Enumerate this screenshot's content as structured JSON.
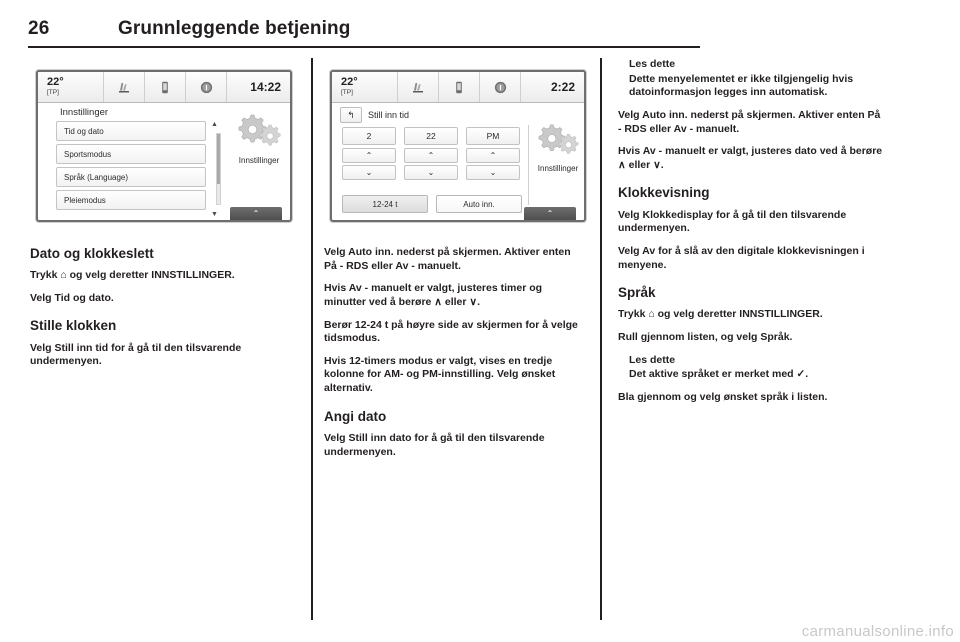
{
  "header": {
    "page_number": "26",
    "title": "Grunnleggende betjening"
  },
  "screens": {
    "screen1": {
      "status": {
        "temperature": "22°",
        "tp": "[TP]",
        "time": "14:22",
        "icons": [
          "seat-heating-icon",
          "phone-icon",
          "info-icon"
        ]
      },
      "title": "Innstillinger",
      "menu_items": [
        "Tid og dato",
        "Sportsmodus",
        "Språk (Language)",
        "Pleiemodus"
      ],
      "scroll_up": "▲",
      "scroll_down": "▼",
      "right_label": "Innstillinger",
      "home_chevron": "⌃"
    },
    "screen2": {
      "status": {
        "temperature": "22°",
        "tp": "[TP]",
        "time": "2:22",
        "icons": [
          "seat-heating-icon",
          "phone-icon",
          "info-icon"
        ]
      },
      "back_glyph": "↰",
      "title": "Still inn tid",
      "steppers": [
        {
          "value": "2",
          "up": "⌃",
          "down": "⌄"
        },
        {
          "value": "22",
          "up": "⌃",
          "down": "⌄"
        },
        {
          "value": "PM",
          "up": "⌃",
          "down": "⌄"
        }
      ],
      "buttons": [
        "12-24 t",
        "Auto inn."
      ],
      "right_label": "Innstillinger",
      "home_chevron": "⌃"
    }
  },
  "column1": {
    "heading": "Dato og klokkeslett",
    "p1": "Trykk ⌂ og velg deretter INNSTILLINGER.",
    "p2": "Velg Tid og dato.",
    "heading2": "Stille klokken",
    "p3": "Velg Still inn tid for å gå til den tilsvarende undermenyen."
  },
  "column2": {
    "p1": "Velg Auto inn. nederst på skjermen. Aktiver enten På - RDS eller Av - manuelt.",
    "p2": "Hvis Av - manuelt er valgt, justeres timer og minutter ved å berøre ∧ eller ∨.",
    "p3": "Berør 12-24 t på høyre side av skjermen for å velge tidsmodus.",
    "p4": "Hvis 12-timers modus er valgt, vises en tredje kolonne for AM- og PM-innstilling. Velg ønsket alternativ.",
    "heading": "Angi dato",
    "p5": "Velg Still inn dato for å gå til den tilsvarende undermenyen."
  },
  "column3": {
    "note1_title": "Les dette",
    "note1_body": "Dette menyelementet er ikke tilgjengelig hvis datoinformasjon legges inn automatisk.",
    "p1": "Velg Auto inn. nederst på skjermen. Aktiver enten På - RDS eller Av - manuelt.",
    "p2": "Hvis Av - manuelt er valgt, justeres dato ved å berøre ∧ eller ∨.",
    "heading1": "Klokkevisning",
    "p3": "Velg Klokkedisplay for å gå til den tilsvarende undermenyen.",
    "p4": "Velg Av for å slå av den digitale klokkevisningen i menyene.",
    "heading2": "Språk",
    "p5": "Trykk ⌂ og velg deretter INNSTILLINGER.",
    "p6": "Rull gjennom listen, og velg Språk.",
    "note2_title": "Les dette",
    "note2_body": "Det aktive språket er merket med ✓.",
    "p7": "Bla gjennom og velg ønsket språk i listen."
  },
  "watermark": "carmanualsonline.info"
}
